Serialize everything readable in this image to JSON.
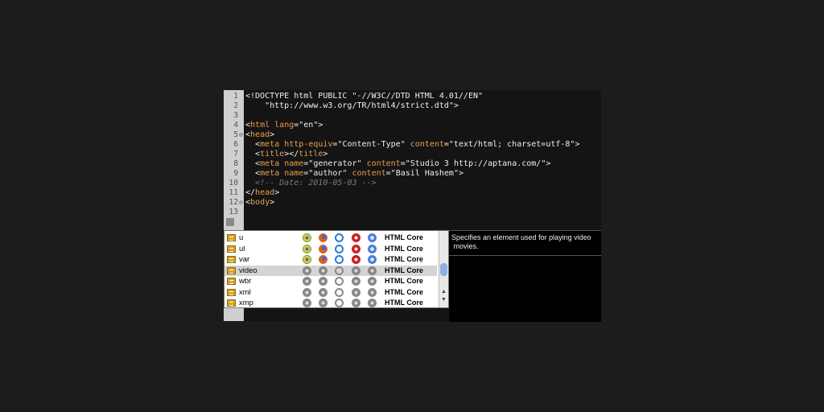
{
  "editor": {
    "lines": [
      {
        "n": "1",
        "tokens": [
          {
            "k": "p",
            "v": "<!DOCTYPE html PUBLIC \"-//W3C//DTD HTML 4.01//EN\""
          }
        ]
      },
      {
        "n": "2",
        "tokens": [
          {
            "k": "p",
            "v": "    \"http://www.w3.org/TR/html4/strict.dtd\">"
          }
        ]
      },
      {
        "n": "3",
        "tokens": []
      },
      {
        "n": "4",
        "tokens": [
          {
            "k": "p",
            "v": "<"
          },
          {
            "k": "t",
            "v": "html"
          },
          {
            "k": "p",
            "v": " "
          },
          {
            "k": "a",
            "v": "lang"
          },
          {
            "k": "p",
            "v": "=\"en\">"
          }
        ]
      },
      {
        "n": "5",
        "tokens": [
          {
            "k": "p",
            "v": "<"
          },
          {
            "k": "t",
            "v": "head"
          },
          {
            "k": "p",
            "v": ">"
          }
        ]
      },
      {
        "n": "6",
        "tokens": [
          {
            "k": "p",
            "v": "  <"
          },
          {
            "k": "t",
            "v": "meta"
          },
          {
            "k": "p",
            "v": " "
          },
          {
            "k": "a",
            "v": "http-equiv"
          },
          {
            "k": "p",
            "v": "=\"Content-Type\" "
          },
          {
            "k": "a",
            "v": "content"
          },
          {
            "k": "p",
            "v": "=\"text/html; charset=utf-8\">"
          }
        ]
      },
      {
        "n": "7",
        "tokens": [
          {
            "k": "p",
            "v": "  <"
          },
          {
            "k": "t",
            "v": "title"
          },
          {
            "k": "p",
            "v": "></"
          },
          {
            "k": "t",
            "v": "title"
          },
          {
            "k": "p",
            "v": ">"
          }
        ]
      },
      {
        "n": "8",
        "tokens": [
          {
            "k": "p",
            "v": "  <"
          },
          {
            "k": "t",
            "v": "meta"
          },
          {
            "k": "p",
            "v": " "
          },
          {
            "k": "a",
            "v": "name"
          },
          {
            "k": "p",
            "v": "=\"generator\" "
          },
          {
            "k": "a",
            "v": "content"
          },
          {
            "k": "p",
            "v": "=\"Studio 3 http://aptana.com/\">"
          }
        ]
      },
      {
        "n": "9",
        "tokens": [
          {
            "k": "p",
            "v": "  <"
          },
          {
            "k": "t",
            "v": "meta"
          },
          {
            "k": "p",
            "v": " "
          },
          {
            "k": "a",
            "v": "name"
          },
          {
            "k": "p",
            "v": "=\"author\" "
          },
          {
            "k": "a",
            "v": "content"
          },
          {
            "k": "p",
            "v": "=\"Basil Hashem\">"
          }
        ]
      },
      {
        "n": "10",
        "tokens": [
          {
            "k": "c",
            "v": "  <!-- Date: 2010-05-03 -->"
          }
        ]
      },
      {
        "n": "11",
        "tokens": [
          {
            "k": "p",
            "v": "</"
          },
          {
            "k": "t",
            "v": "head"
          },
          {
            "k": "p",
            "v": ">"
          }
        ]
      },
      {
        "n": "12",
        "tokens": [
          {
            "k": "p",
            "v": "<"
          },
          {
            "k": "t",
            "v": "body"
          },
          {
            "k": "p",
            "v": ">"
          }
        ]
      },
      {
        "n": "13",
        "tokens": []
      }
    ],
    "fold_markers": [
      {
        "line": "5",
        "glyph": "⊖"
      },
      {
        "line": "12",
        "glyph": "⊖"
      }
    ]
  },
  "autocomplete": {
    "items": [
      {
        "name": "u",
        "source": "HTML Core",
        "browser_icons": [
          "chrome-icon",
          "firefox-icon",
          "ie-icon",
          "opera-icon",
          "safari-icon"
        ],
        "supported": true
      },
      {
        "name": "ul",
        "source": "HTML Core",
        "browser_icons": [
          "chrome-icon",
          "firefox-icon",
          "ie-icon",
          "opera-icon",
          "safari-icon"
        ],
        "supported": true
      },
      {
        "name": "var",
        "source": "HTML Core",
        "browser_icons": [
          "chrome-icon",
          "firefox-icon",
          "ie-icon",
          "opera-icon",
          "safari-icon"
        ],
        "supported": true
      },
      {
        "name": "video",
        "source": "HTML Core",
        "browser_icons": [
          "chrome-icon",
          "firefox-icon",
          "ie-icon",
          "opera-icon",
          "safari-icon"
        ],
        "supported": false,
        "selected": true
      },
      {
        "name": "wbr",
        "source": "HTML Core",
        "browser_icons": [
          "chrome-icon",
          "firefox-icon",
          "ie-icon",
          "opera-icon",
          "safari-icon"
        ],
        "supported": false
      },
      {
        "name": "xml",
        "source": "HTML Core",
        "browser_icons": [
          "chrome-icon",
          "firefox-icon",
          "ie-icon",
          "opera-icon",
          "safari-icon"
        ],
        "supported": false
      },
      {
        "name": "xmp",
        "source": "HTML Core",
        "browser_icons": [
          "chrome-icon",
          "firefox-icon",
          "ie-icon",
          "opera-icon",
          "safari-icon"
        ],
        "supported": false
      }
    ]
  },
  "doc_panel": {
    "text": "Specifies an element used for playing video\n movies."
  }
}
